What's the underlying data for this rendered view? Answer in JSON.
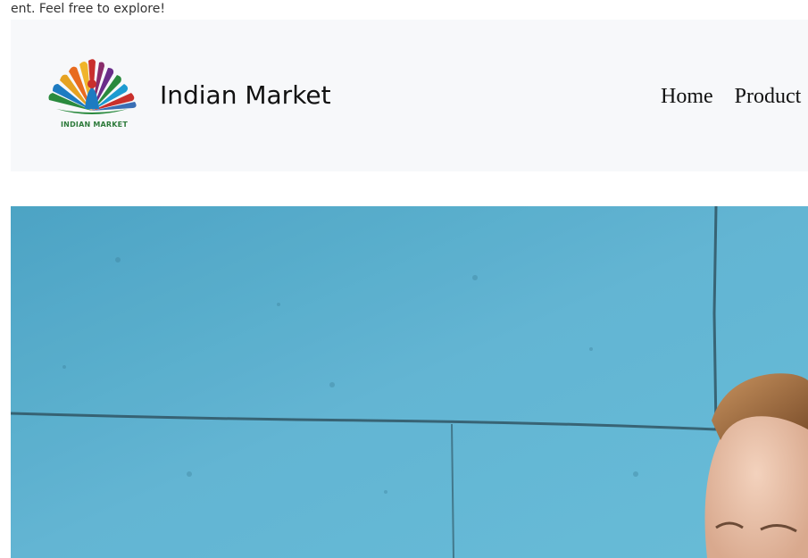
{
  "announcement": {
    "text": "ent. Feel free to explore!"
  },
  "header": {
    "logo_text": "INDIAN MARKET",
    "brand_name": "Indian Market",
    "nav": [
      {
        "label": "Home"
      },
      {
        "label": "Product"
      }
    ]
  },
  "colors": {
    "navbar_bg": "#f7f8fa",
    "wall": "#5fb3d1",
    "logo_text": "#2d7a3a"
  },
  "hero": {
    "image": "man-smiling-in-front-of-blue-wall"
  }
}
